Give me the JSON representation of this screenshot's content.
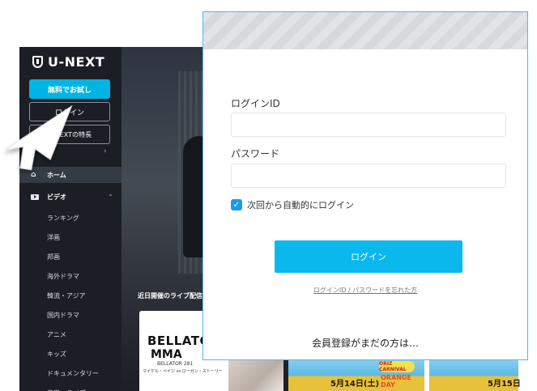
{
  "app": {
    "logo_text": "U-NEXT",
    "trial_button": "無料でお試し",
    "login_button": "ログイン",
    "features_button": "U-NEXTの特長",
    "nav_home": "ホーム",
    "nav_video": "ビデオ",
    "subnav": [
      "ランキング",
      "洋画",
      "邦画",
      "海外ドラマ",
      "韓流・アジア",
      "国内ドラマ",
      "アニメ",
      "キッズ",
      "ドキュメンタリー",
      "音楽・ライブ"
    ],
    "live_section_title": "近日開催のライブ配信",
    "thumb_bellator": "BELLATOR",
    "thumb_mma": "MMA",
    "thumb_bellator_num": "BELLATOR 281",
    "thumb_fighters": "マイケル・ペイジ vs ローガン・ストーリー",
    "thumb_date_1": "5月14日(土)",
    "thumb_sub_1": "ORANGE DAY",
    "thumb_carnival": "ORIZ CARNIVAL",
    "thumb_date_2": "5月15日"
  },
  "login_modal": {
    "id_label": "ログインID",
    "id_value": "",
    "password_label": "パスワード",
    "password_value": "",
    "auto_login_label": "次回から自動的にログイン",
    "auto_login_checked": true,
    "login_button": "ログイン",
    "forgot_link": "ログインID / パスワードを忘れた方",
    "register_prompt": "会員登録がまだの方は…"
  },
  "colors": {
    "accent": "#0ab8ee",
    "checkbox": "#1e9be3",
    "sidebar_bg": "#1b1f25",
    "modal_border": "#5ab4e6"
  },
  "icons": [
    "shield-logo-icon",
    "home-icon",
    "video-icon",
    "chevron-right-icon",
    "chevron-up-icon",
    "check-icon",
    "mouse-cursor-icon"
  ]
}
